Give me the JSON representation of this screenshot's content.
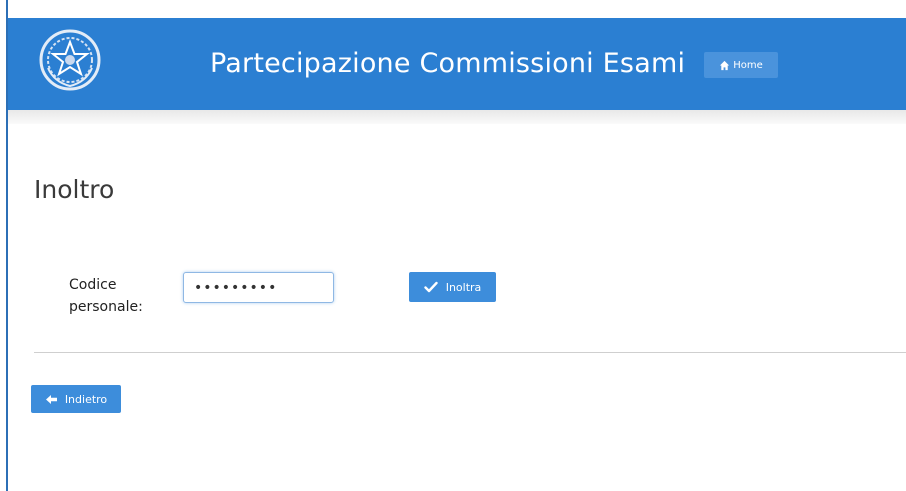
{
  "header": {
    "site_title": "Partecipazione Commissioni Esami",
    "home_label": "Home",
    "brand_color": "#2b7fd2"
  },
  "page": {
    "title": "Inoltro"
  },
  "form": {
    "code_label": "Codice personale:",
    "code_value": "•••••••••",
    "submit_label": "Inoltra",
    "submit_icon": "check-icon"
  },
  "nav": {
    "back_label": "Indietro",
    "back_icon": "arrow-left-icon"
  },
  "colors": {
    "button": "#3d8ddb",
    "header": "#2b7fd2"
  }
}
